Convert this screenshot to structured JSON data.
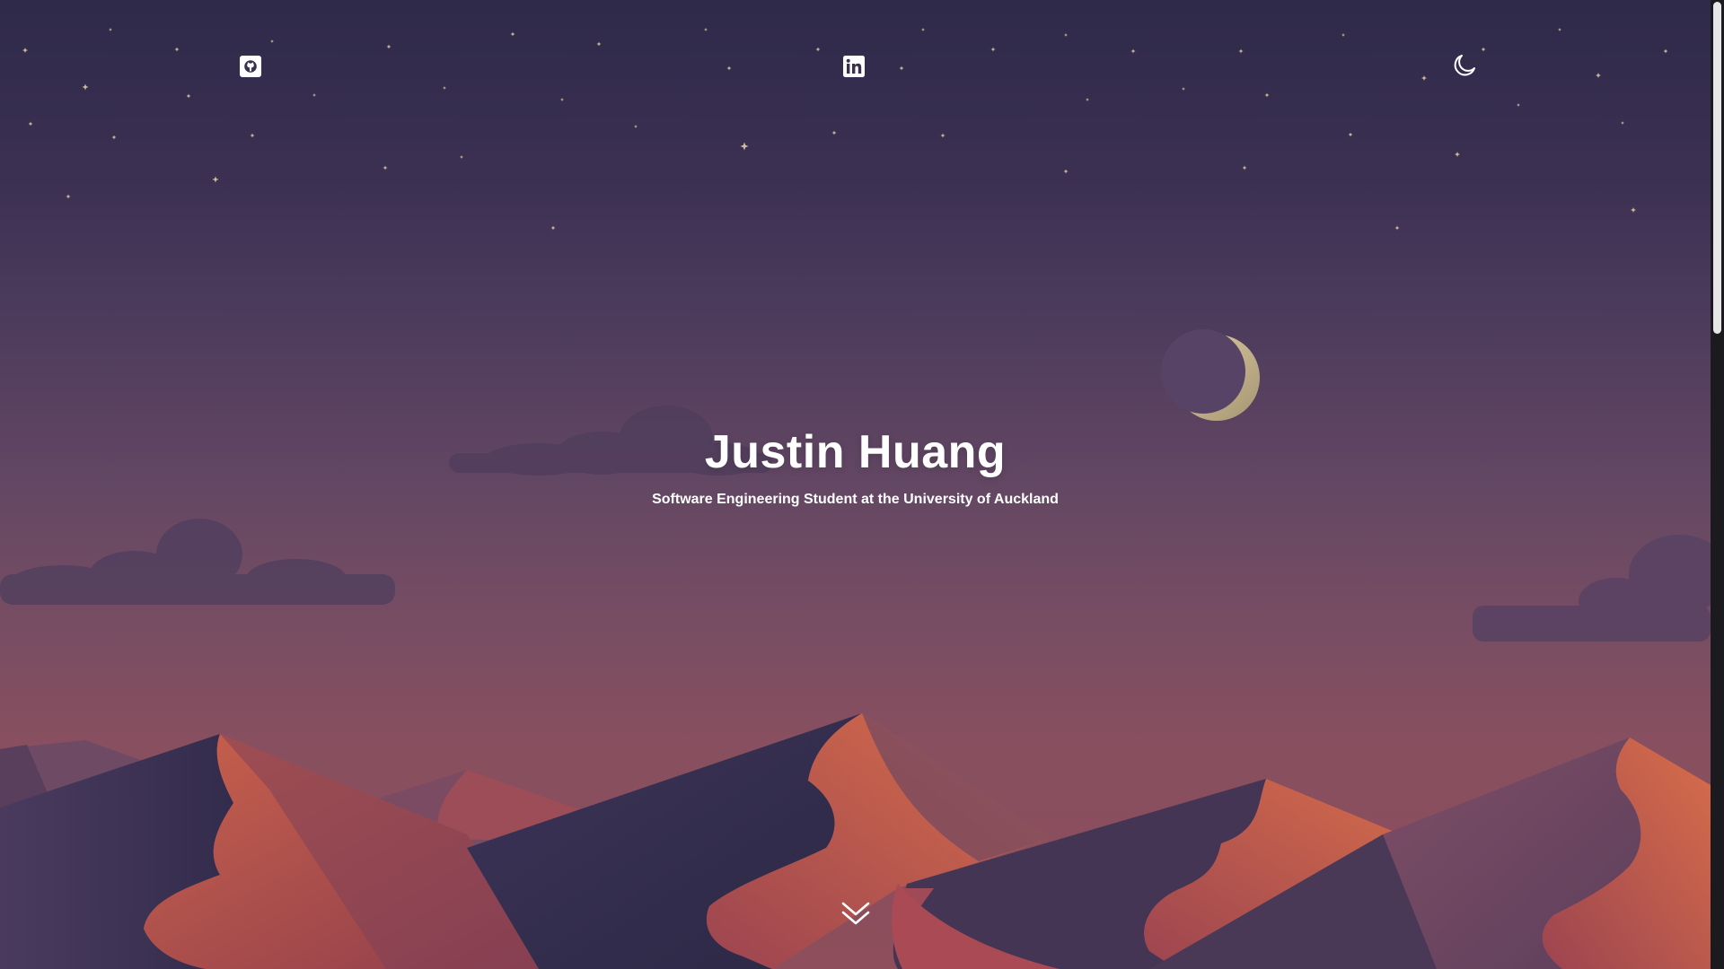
{
  "hero": {
    "name": "Justin Huang",
    "subtitle": "Software Engineering Student at the University of Auckland"
  },
  "nav": {
    "icons": [
      "github-icon",
      "linkedin-icon",
      "moon-icon"
    ]
  },
  "scroll": {
    "icon": "double-chevron-down-icon"
  },
  "colors": {
    "sky_top": "#2f2a4a",
    "sky_mid": "#634763",
    "sky_bottom": "#8e4e5c",
    "star": "#e9d7a6",
    "moon": "#c9b78e",
    "dune_dark": "#3b3354",
    "dune_rust": "#b8564f",
    "text": "#ffffff"
  }
}
